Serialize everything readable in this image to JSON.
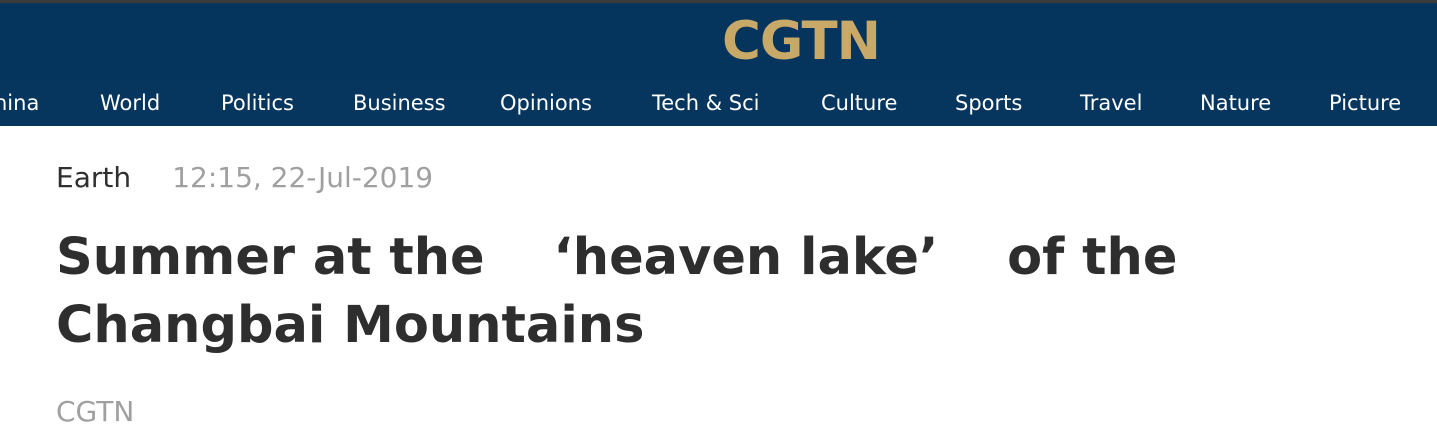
{
  "header": {
    "logo_text": "CGTN",
    "colors": {
      "header_bg": "#05345c",
      "logo": "#c8a968",
      "nav_text": "#ffffff"
    }
  },
  "nav": {
    "items": [
      {
        "label": "hina"
      },
      {
        "label": "World"
      },
      {
        "label": "Politics"
      },
      {
        "label": "Business"
      },
      {
        "label": "Opinions"
      },
      {
        "label": "Tech & Sci"
      },
      {
        "label": "Culture"
      },
      {
        "label": "Sports"
      },
      {
        "label": "Travel"
      },
      {
        "label": "Nature"
      },
      {
        "label": "Picture"
      }
    ]
  },
  "article": {
    "category": "Earth",
    "timestamp": "12:15, 22-Jul-2019",
    "title": "Summer at the 　‘heaven lake’　 of the Changbai Mountains",
    "source": "CGTN"
  }
}
